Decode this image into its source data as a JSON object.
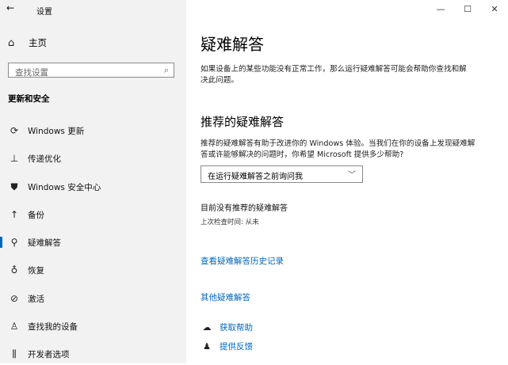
{
  "window": {
    "title": "设置",
    "controls": {
      "minimize": "—",
      "maximize": "☐",
      "close": "✕"
    }
  },
  "sidebar": {
    "home_label": "主页",
    "search_placeholder": "查找设置",
    "section_heading": "更新和安全",
    "items": [
      {
        "label": "Windows 更新",
        "icon": "refresh-icon"
      },
      {
        "label": "传递优化",
        "icon": "delivery-icon"
      },
      {
        "label": "Windows 安全中心",
        "icon": "shield-icon"
      },
      {
        "label": "备份",
        "icon": "backup-arrow-icon"
      },
      {
        "label": "疑难解答",
        "icon": "wrench-icon",
        "selected": true
      },
      {
        "label": "恢复",
        "icon": "recovery-icon"
      },
      {
        "label": "激活",
        "icon": "check-circle-icon"
      },
      {
        "label": "查找我的设备",
        "icon": "person-location-icon"
      },
      {
        "label": "开发者选项",
        "icon": "developer-icon"
      }
    ]
  },
  "main": {
    "title": "疑难解答",
    "intro": "如果设备上的某些功能没有正常工作，那么运行疑难解答可能会帮助你查找和解决此问题。",
    "recommended_heading": "推荐的疑难解答",
    "recommended_desc": "推荐的疑难解答有助于改进你的 Windows 体验。当我们在你的设备上发现疑难解答或许能够解决的问题时，你希望 Microsoft 提供多少帮助?",
    "dropdown_value": "在运行疑难解答之前询问我",
    "status": "目前没有推荐的疑难解答",
    "last_check": "上次检查时间: 从未",
    "history_link": "查看疑难解答历史记录",
    "other_link": "其他疑难解答",
    "help": [
      {
        "label": "获取帮助",
        "icon": "help-chat-icon"
      },
      {
        "label": "提供反馈",
        "icon": "feedback-icon"
      }
    ]
  },
  "colors": {
    "accent": "#0067c0",
    "sidebar_bg": "#f2f2f2"
  }
}
